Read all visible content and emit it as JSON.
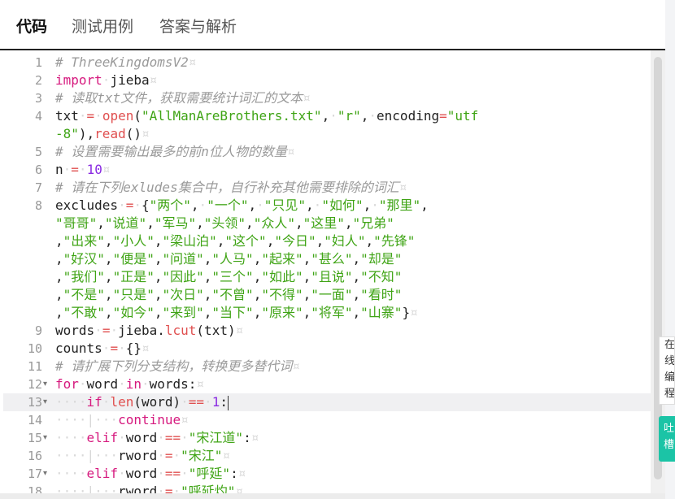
{
  "tabs": [
    {
      "label": "代码",
      "active": true
    },
    {
      "label": "测试用例",
      "active": false
    },
    {
      "label": "答案与解析",
      "active": false
    }
  ],
  "editor": {
    "active_line": 13,
    "lines": [
      {
        "n": "1",
        "fold": false,
        "tokens": [
          [
            "cmt",
            "# ThreeKingdomsV2"
          ],
          [
            "ws",
            "¤"
          ]
        ]
      },
      {
        "n": "2",
        "fold": false,
        "tokens": [
          [
            "kw",
            "import"
          ],
          [
            "ws",
            "·"
          ],
          [
            "",
            "jieba"
          ],
          [
            "ws",
            "¤"
          ]
        ]
      },
      {
        "n": "3",
        "fold": false,
        "tokens": [
          [
            "cmt",
            "# 读取txt文件，获取需要统计词汇的文本"
          ],
          [
            "ws",
            "¤"
          ]
        ]
      },
      {
        "n": "4",
        "fold": false,
        "tokens": [
          [
            "",
            "txt"
          ],
          [
            "ws",
            "·"
          ],
          [
            "op",
            "="
          ],
          [
            "ws",
            "·"
          ],
          [
            "fn",
            "open"
          ],
          [
            "",
            "("
          ],
          [
            "str",
            "\"AllManAreBrothers.txt\""
          ],
          [
            "",
            ","
          ],
          [
            "ws",
            "·"
          ],
          [
            "str",
            "\"r\""
          ],
          [
            "",
            ","
          ],
          [
            "ws",
            "·"
          ],
          [
            "",
            "encoding"
          ],
          [
            "op",
            "="
          ],
          [
            "str",
            "\"utf"
          ]
        ]
      },
      {
        "n": "",
        "fold": false,
        "tokens": [
          [
            "str",
            "-8\""
          ],
          [
            "",
            "),"
          ],
          [
            "fn",
            "read"
          ],
          [
            "",
            "()"
          ],
          [
            "ws",
            "¤"
          ]
        ]
      },
      {
        "n": "5",
        "fold": false,
        "tokens": [
          [
            "cmt",
            "# 设置需要输出最多的前n位人物的数量"
          ],
          [
            "ws",
            "¤"
          ]
        ]
      },
      {
        "n": "6",
        "fold": false,
        "tokens": [
          [
            "",
            "n"
          ],
          [
            "ws",
            "·"
          ],
          [
            "op",
            "="
          ],
          [
            "ws",
            "·"
          ],
          [
            "num",
            "10"
          ],
          [
            "ws",
            "¤"
          ]
        ]
      },
      {
        "n": "7",
        "fold": false,
        "tokens": [
          [
            "cmt",
            "# 请在下列exludes集合中，自行补充其他需要排除的词汇"
          ],
          [
            "ws",
            "¤"
          ]
        ]
      },
      {
        "n": "8",
        "fold": false,
        "tokens": [
          [
            "",
            "excludes"
          ],
          [
            "ws",
            "·"
          ],
          [
            "op",
            "="
          ],
          [
            "ws",
            "·"
          ],
          [
            "",
            "{"
          ],
          [
            "str",
            "\"两个\""
          ],
          [
            "",
            ","
          ],
          [
            "ws",
            "·"
          ],
          [
            "str",
            "\"一个\""
          ],
          [
            "",
            ","
          ],
          [
            "ws",
            "·"
          ],
          [
            "str",
            "\"只见\""
          ],
          [
            "",
            ","
          ],
          [
            "ws",
            "·"
          ],
          [
            "str",
            "\"如何\""
          ],
          [
            "",
            ","
          ],
          [
            "ws",
            "·"
          ],
          [
            "str",
            "\"那里\""
          ],
          [
            "",
            ","
          ]
        ]
      },
      {
        "n": "",
        "fold": false,
        "tokens": [
          [
            "str",
            "\"哥哥\""
          ],
          [
            "",
            ","
          ],
          [
            "str",
            "\"说道\""
          ],
          [
            "",
            ","
          ],
          [
            "str",
            "\"军马\""
          ],
          [
            "",
            ","
          ],
          [
            "str",
            "\"头领\""
          ],
          [
            "",
            ","
          ],
          [
            "str",
            "\"众人\""
          ],
          [
            "",
            ","
          ],
          [
            "str",
            "\"这里\""
          ],
          [
            "",
            ","
          ],
          [
            "str",
            "\"兄弟\""
          ]
        ]
      },
      {
        "n": "",
        "fold": false,
        "tokens": [
          [
            "",
            ","
          ],
          [
            "str",
            "\"出来\""
          ],
          [
            "",
            ","
          ],
          [
            "str",
            "\"小人\""
          ],
          [
            "",
            ","
          ],
          [
            "str",
            "\"梁山泊\""
          ],
          [
            "",
            ","
          ],
          [
            "str",
            "\"这个\""
          ],
          [
            "",
            ","
          ],
          [
            "str",
            "\"今日\""
          ],
          [
            "",
            ","
          ],
          [
            "str",
            "\"妇人\""
          ],
          [
            "",
            ","
          ],
          [
            "str",
            "\"先锋\""
          ]
        ]
      },
      {
        "n": "",
        "fold": false,
        "tokens": [
          [
            "",
            ","
          ],
          [
            "str",
            "\"好汉\""
          ],
          [
            "",
            ","
          ],
          [
            "str",
            "\"便是\""
          ],
          [
            "",
            ","
          ],
          [
            "str",
            "\"问道\""
          ],
          [
            "",
            ","
          ],
          [
            "str",
            "\"人马\""
          ],
          [
            "",
            ","
          ],
          [
            "str",
            "\"起来\""
          ],
          [
            "",
            ","
          ],
          [
            "str",
            "\"甚么\""
          ],
          [
            "",
            ","
          ],
          [
            "str",
            "\"却是\""
          ]
        ]
      },
      {
        "n": "",
        "fold": false,
        "tokens": [
          [
            "",
            ","
          ],
          [
            "str",
            "\"我们\""
          ],
          [
            "",
            ","
          ],
          [
            "str",
            "\"正是\""
          ],
          [
            "",
            ","
          ],
          [
            "str",
            "\"因此\""
          ],
          [
            "",
            ","
          ],
          [
            "str",
            "\"三个\""
          ],
          [
            "",
            ","
          ],
          [
            "str",
            "\"如此\""
          ],
          [
            "",
            ","
          ],
          [
            "str",
            "\"且说\""
          ],
          [
            "",
            ","
          ],
          [
            "str",
            "\"不知\""
          ]
        ]
      },
      {
        "n": "",
        "fold": false,
        "tokens": [
          [
            "",
            ","
          ],
          [
            "str",
            "\"不是\""
          ],
          [
            "",
            ","
          ],
          [
            "str",
            "\"只是\""
          ],
          [
            "",
            ","
          ],
          [
            "str",
            "\"次日\""
          ],
          [
            "",
            ","
          ],
          [
            "str",
            "\"不曾\""
          ],
          [
            "",
            ","
          ],
          [
            "str",
            "\"不得\""
          ],
          [
            "",
            ","
          ],
          [
            "str",
            "\"一面\""
          ],
          [
            "",
            ","
          ],
          [
            "str",
            "\"看时\""
          ]
        ]
      },
      {
        "n": "",
        "fold": false,
        "tokens": [
          [
            "",
            ","
          ],
          [
            "str",
            "\"不敢\""
          ],
          [
            "",
            ","
          ],
          [
            "str",
            "\"如今\""
          ],
          [
            "",
            ","
          ],
          [
            "str",
            "\"来到\""
          ],
          [
            "",
            ","
          ],
          [
            "str",
            "\"当下\""
          ],
          [
            "",
            ","
          ],
          [
            "str",
            "\"原来\""
          ],
          [
            "",
            ","
          ],
          [
            "str",
            "\"将军\""
          ],
          [
            "",
            ","
          ],
          [
            "str",
            "\"山寨\""
          ],
          [
            "",
            "}"
          ],
          [
            "ws",
            "¤"
          ]
        ]
      },
      {
        "n": "9",
        "fold": false,
        "tokens": [
          [
            "",
            "words"
          ],
          [
            "ws",
            "·"
          ],
          [
            "op",
            "="
          ],
          [
            "ws",
            "·"
          ],
          [
            "",
            "jieba."
          ],
          [
            "fn",
            "lcut"
          ],
          [
            "",
            "(txt)"
          ],
          [
            "ws",
            "¤"
          ]
        ]
      },
      {
        "n": "10",
        "fold": false,
        "tokens": [
          [
            "",
            "counts"
          ],
          [
            "ws",
            "·"
          ],
          [
            "op",
            "="
          ],
          [
            "ws",
            "·"
          ],
          [
            "",
            "{}"
          ],
          [
            "ws",
            "¤"
          ]
        ]
      },
      {
        "n": "11",
        "fold": false,
        "tokens": [
          [
            "cmt",
            "# 请扩展下列分支结构，转换更多替代词"
          ],
          [
            "ws",
            "¤"
          ]
        ]
      },
      {
        "n": "12",
        "fold": true,
        "tokens": [
          [
            "kw",
            "for"
          ],
          [
            "ws",
            "·"
          ],
          [
            "",
            "word"
          ],
          [
            "ws",
            "·"
          ],
          [
            "kw",
            "in"
          ],
          [
            "ws",
            "·"
          ],
          [
            "",
            "words:"
          ],
          [
            "ws",
            "¤"
          ]
        ]
      },
      {
        "n": "13",
        "fold": true,
        "tokens": [
          [
            "ws",
            "····"
          ],
          [
            "kw",
            "if"
          ],
          [
            "ws",
            "·"
          ],
          [
            "fn",
            "len"
          ],
          [
            "",
            "(word)"
          ],
          [
            "ws",
            "·"
          ],
          [
            "op",
            "=="
          ],
          [
            "ws",
            "·"
          ],
          [
            "num",
            "1"
          ],
          [
            "",
            ":"
          ]
        ]
      },
      {
        "n": "14",
        "fold": false,
        "tokens": [
          [
            "ws",
            "····|···"
          ],
          [
            "kw",
            "continue"
          ],
          [
            "ws",
            "¤"
          ]
        ]
      },
      {
        "n": "15",
        "fold": true,
        "tokens": [
          [
            "ws",
            "····"
          ],
          [
            "kw",
            "elif"
          ],
          [
            "ws",
            "·"
          ],
          [
            "",
            "word"
          ],
          [
            "ws",
            "·"
          ],
          [
            "op",
            "=="
          ],
          [
            "ws",
            "·"
          ],
          [
            "str",
            "\"宋江道\""
          ],
          [
            "",
            ":"
          ],
          [
            "ws",
            "¤"
          ]
        ]
      },
      {
        "n": "16",
        "fold": false,
        "tokens": [
          [
            "ws",
            "····|···"
          ],
          [
            "",
            "rword"
          ],
          [
            "ws",
            "·"
          ],
          [
            "op",
            "="
          ],
          [
            "ws",
            "·"
          ],
          [
            "str",
            "\"宋江\""
          ],
          [
            "ws",
            "¤"
          ]
        ]
      },
      {
        "n": "17",
        "fold": true,
        "tokens": [
          [
            "ws",
            "····"
          ],
          [
            "kw",
            "elif"
          ],
          [
            "ws",
            "·"
          ],
          [
            "",
            "word"
          ],
          [
            "ws",
            "·"
          ],
          [
            "op",
            "=="
          ],
          [
            "ws",
            "·"
          ],
          [
            "str",
            "\"呼延\""
          ],
          [
            "",
            ":"
          ],
          [
            "ws",
            "¤"
          ]
        ]
      },
      {
        "n": "18",
        "fold": false,
        "tokens": [
          [
            "ws",
            "····|···"
          ],
          [
            "",
            "rword"
          ],
          [
            "ws",
            "·"
          ],
          [
            "op",
            "="
          ],
          [
            "ws",
            "·"
          ],
          [
            "str",
            "\"呼延灼\""
          ],
          [
            "ws",
            "¤"
          ]
        ]
      }
    ]
  },
  "side_note": {
    "text": "在线编程"
  },
  "side_button": {
    "label": "吐槽"
  },
  "colors": {
    "comment": "#9a9a9a",
    "keyword": "#d6197e",
    "string": "#3fa415",
    "number": "#8a2be2",
    "accent": "#1bc4a6"
  }
}
